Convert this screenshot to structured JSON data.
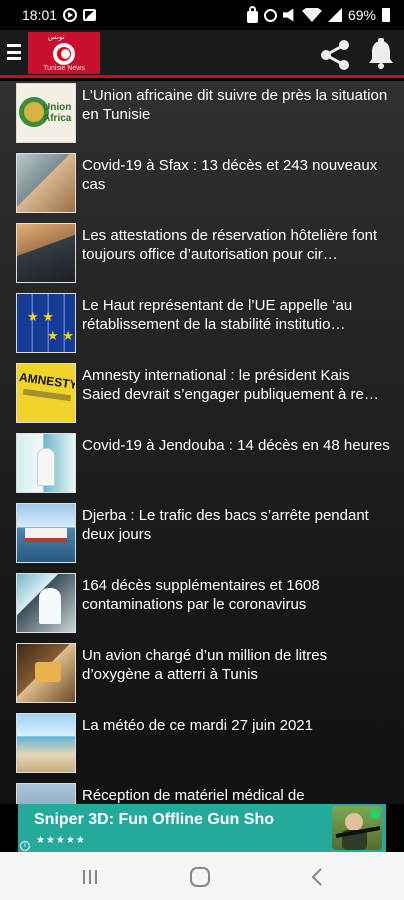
{
  "status_bar": {
    "time": "18:01",
    "battery": "69%",
    "icons": [
      "circle-play-icon",
      "image-icon",
      "lock-icon",
      "alarm-icon",
      "mute-icon",
      "wifi-icon",
      "signal-icon",
      "battery-icon"
    ]
  },
  "app_bar": {
    "logo_arabic": "تونس",
    "logo_subtitle": "Tunisie News",
    "brand_color": "#d00d0d",
    "menu_icon": "hamburger-menu-icon",
    "share_icon": "share-icon",
    "notification_icon": "bell-icon"
  },
  "news": [
    {
      "title": "L’Union africaine dit suivre de près la situation en Tunisie",
      "thumb_icon": "african-union-logo-image",
      "thumb_label": "Union Africa"
    },
    {
      "title": "Covid-19 à Sfax : 13 décès et 243 nouveaux cas",
      "thumb_icon": "hospital-image"
    },
    {
      "title": "Les attestations de réservation hôtelière font toujours office d’autorisation pour cir…",
      "thumb_icon": "laptop-image"
    },
    {
      "title": "Le Haut représentant de l’UE appelle ‘au rétablissement de la stabilité institutio…",
      "thumb_icon": "eu-flags-image"
    },
    {
      "title": "Amnesty international : le président Kais Saied devrait s’engager publiquement à re…",
      "thumb_icon": "amnesty-logo-image",
      "thumb_label": "AMNESTY"
    },
    {
      "title": "Covid-19 à Jendouba : 14 décès en 48 heures",
      "thumb_icon": "medical-staff-image"
    },
    {
      "title": "Djerba : Le trafic des bacs s’arrête pendant deux jours",
      "thumb_icon": "ferry-image"
    },
    {
      "title": "164 décès supplémentaires et 1608 contaminations par le coronavirus",
      "thumb_icon": "covid-lab-image"
    },
    {
      "title": "Un avion chargé d’un million de litres d’oxygène a atterri à Tunis",
      "thumb_icon": "airplane-cargo-image"
    },
    {
      "title": "La météo de ce mardi 27 juin 2021",
      "thumb_icon": "beach-image"
    },
    {
      "title": "Réception de matériel médical de",
      "thumb_icon": "medical-equipment-image"
    }
  ],
  "ad": {
    "title": "Sniper 3D: Fun Offline Gun Sho",
    "stars": "★★★★★",
    "info_icon": "info-icon",
    "color": "#24a99b"
  },
  "navigation": {
    "recent_icon": "recent-apps-icon",
    "home_icon": "home-icon",
    "back_icon": "back-icon"
  }
}
